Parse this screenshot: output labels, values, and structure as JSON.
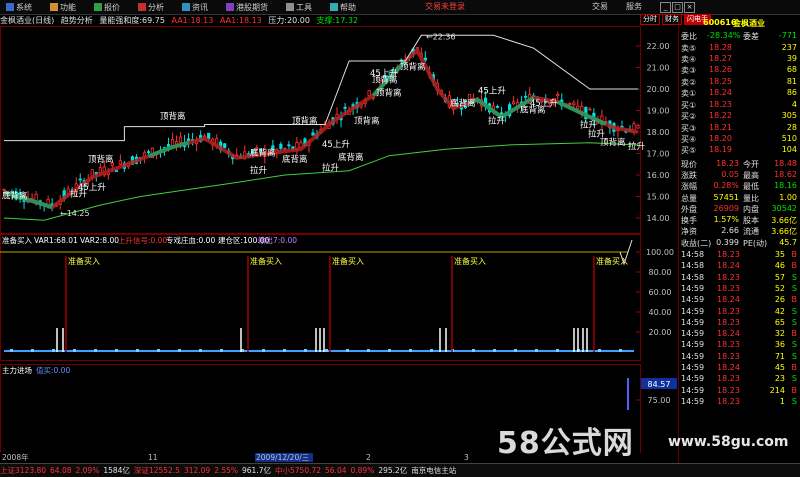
{
  "menubar": {
    "items": [
      {
        "label": "系统",
        "icon": "system-icon"
      },
      {
        "label": "功能",
        "icon": "function-icon"
      },
      {
        "label": "报价",
        "icon": "quote-icon"
      },
      {
        "label": "分析",
        "icon": "analysis-icon"
      },
      {
        "label": "资讯",
        "icon": "news-icon"
      },
      {
        "label": "港股期货",
        "icon": "futures-icon"
      },
      {
        "label": "工具",
        "icon": "tools-icon"
      },
      {
        "label": "帮助",
        "icon": "help-icon"
      }
    ],
    "login": "交易未登录",
    "trade": "交易",
    "service": "服务",
    "win_min": "_",
    "win_max": "□",
    "win_close": "×"
  },
  "infobar": {
    "title": "金枫酒业(日线)",
    "ind1": "趋势分析",
    "ind2": "量能强和度:69.75",
    "aa1": "AA1:18.13",
    "aa2": "AA1:18.13",
    "pressure": "压力:20.00",
    "support": "支撑:17.32"
  },
  "tabs": [
    "分时",
    "财务",
    "闪电手"
  ],
  "stock": {
    "code": "600616",
    "name": "金枫酒业"
  },
  "quote": {
    "webi_label": "委比",
    "webi": "-28.34%",
    "wecha_label": "委差",
    "wecha": "-771",
    "sells": [
      {
        "label": "卖⑤",
        "price": "18.28",
        "vol": "237"
      },
      {
        "label": "卖④",
        "price": "18.27",
        "vol": "39"
      },
      {
        "label": "卖③",
        "price": "18.26",
        "vol": "68"
      },
      {
        "label": "卖②",
        "price": "18.25",
        "vol": "81"
      },
      {
        "label": "卖①",
        "price": "18.24",
        "vol": "86"
      }
    ],
    "buys": [
      {
        "label": "买①",
        "price": "18.23",
        "vol": "4"
      },
      {
        "label": "买②",
        "price": "18.22",
        "vol": "305"
      },
      {
        "label": "买③",
        "price": "18.21",
        "vol": "28"
      },
      {
        "label": "买④",
        "price": "18.20",
        "vol": "510"
      },
      {
        "label": "买⑤",
        "price": "18.19",
        "vol": "104"
      }
    ],
    "stats": [
      {
        "l1": "现价",
        "v1": "18.23",
        "l2": "今开",
        "v2": "18.48"
      },
      {
        "l1": "涨跌",
        "v1": "0.05",
        "l2": "最高",
        "v2": "18.62"
      },
      {
        "l1": "涨幅",
        "v1": "0.28%",
        "l2": "最低",
        "v2": "18.16"
      },
      {
        "l1": "总量",
        "v1": "57451",
        "l2": "量比",
        "v2": "1.00"
      },
      {
        "l1": "外盘",
        "v1": "26909",
        "l2": "内盘",
        "v2": "30542"
      },
      {
        "l1": "换手",
        "v1": "1.57%",
        "l2": "股本",
        "v2": "3.66亿"
      },
      {
        "l1": "净资",
        "v1": "2.66",
        "l2": "流通",
        "v2": "3.66亿"
      },
      {
        "l1": "收益(二)",
        "v1": "0.399",
        "l2": "PE(动)",
        "v2": "45.7"
      }
    ],
    "ticks": [
      {
        "t": "14:58",
        "p": "18.23",
        "v": "35",
        "d": "B"
      },
      {
        "t": "14:58",
        "p": "18.24",
        "v": "46",
        "d": "B"
      },
      {
        "t": "14:58",
        "p": "18.23",
        "v": "57",
        "d": "S"
      },
      {
        "t": "14:59",
        "p": "18.23",
        "v": "52",
        "d": "S"
      },
      {
        "t": "14:59",
        "p": "18.24",
        "v": "26",
        "d": "B"
      },
      {
        "t": "14:59",
        "p": "18.23",
        "v": "42",
        "d": "S"
      },
      {
        "t": "14:59",
        "p": "18.23",
        "v": "65",
        "d": "S"
      },
      {
        "t": "14:59",
        "p": "18.24",
        "v": "32",
        "d": "B"
      },
      {
        "t": "14:59",
        "p": "18.23",
        "v": "36",
        "d": "S"
      },
      {
        "t": "14:59",
        "p": "18.23",
        "v": "71",
        "d": "S"
      },
      {
        "t": "14:59",
        "p": "18.24",
        "v": "45",
        "d": "B"
      },
      {
        "t": "14:59",
        "p": "18.23",
        "v": "23",
        "d": "S"
      },
      {
        "t": "14:59",
        "p": "18.23",
        "v": "214",
        "d": "B"
      },
      {
        "t": "14:59",
        "p": "18.23",
        "v": "1",
        "d": "S"
      }
    ]
  },
  "main_chart": {
    "y_labels": [
      "22.00",
      "21.00",
      "20.00",
      "19.00",
      "18.00",
      "17.00",
      "16.00",
      "15.00",
      "14.00"
    ],
    "high_label": "22.36",
    "low_label": "14.25",
    "annotations": [
      {
        "text": "底背离"
      },
      {
        "text": "拉升"
      },
      {
        "text": "45上升"
      },
      {
        "text": "顶背离"
      },
      {
        "text": "顶背离"
      },
      {
        "text": "底背离"
      },
      {
        "text": "拉升"
      },
      {
        "text": "顶背离"
      },
      {
        "text": "底背离"
      },
      {
        "text": "45上升"
      },
      {
        "text": "底背离"
      },
      {
        "text": "拉升"
      },
      {
        "text": "45上升"
      },
      {
        "text": "顶背离"
      },
      {
        "text": "顶背离"
      },
      {
        "text": "顶背离"
      },
      {
        "text": "顶背离"
      },
      {
        "text": "45上升"
      },
      {
        "text": "底背离"
      },
      {
        "text": "拉升"
      },
      {
        "text": "45上升"
      },
      {
        "text": "底背离"
      },
      {
        "text": "拉升"
      },
      {
        "text": "拉升"
      },
      {
        "text": "顶背离"
      },
      {
        "text": "拉升"
      }
    ]
  },
  "ind1": {
    "title": "准备买入",
    "var1": "VAR1:68.01",
    "var2": "VAR2:8.00",
    "up": "上升信号:0.00",
    "zl": "专戏庄血:0.00",
    "cc": "建仓区:100.00",
    "out": "输出7:0.00",
    "y_labels": [
      "100.00",
      "80.00",
      "60.00",
      "40.00",
      "20.00"
    ],
    "signals": [
      "准备买入",
      "准备买入",
      "准备买入",
      "准备买入",
      "准备买入"
    ]
  },
  "ind2": {
    "title": "主力进场",
    "value": "值买:0.00",
    "y_labels": [
      "84.57",
      "75.00"
    ]
  },
  "timeline": {
    "labels": [
      "2008年",
      "11",
      "2009/12/20/三",
      "2",
      "3"
    ]
  },
  "status": {
    "items": [
      {
        "text": "上证3123.80",
        "c": "red"
      },
      {
        "text": "64.08",
        "c": "red"
      },
      {
        "text": "2.09%",
        "c": "red"
      },
      {
        "text": "1584亿",
        "c": "wht"
      },
      {
        "text": "深证12552.5",
        "c": "red"
      },
      {
        "text": "312.09",
        "c": "red"
      },
      {
        "text": "2.55%",
        "c": "red"
      },
      {
        "text": "961.7亿",
        "c": "wht"
      },
      {
        "text": "中小5750.72",
        "c": "red"
      },
      {
        "text": "56.04",
        "c": "red"
      },
      {
        "text": "0.89%",
        "c": "red"
      },
      {
        "text": "295.2亿",
        "c": "wht"
      },
      {
        "text": "南京电信主站",
        "c": "wht"
      }
    ]
  },
  "watermark": {
    "text1": "58公式网",
    "text2": "www.58gu.com"
  },
  "colors": {
    "up": "#ff3030",
    "down": "#00e0e0",
    "ma": "#ffffff",
    "band": "#c03030"
  }
}
